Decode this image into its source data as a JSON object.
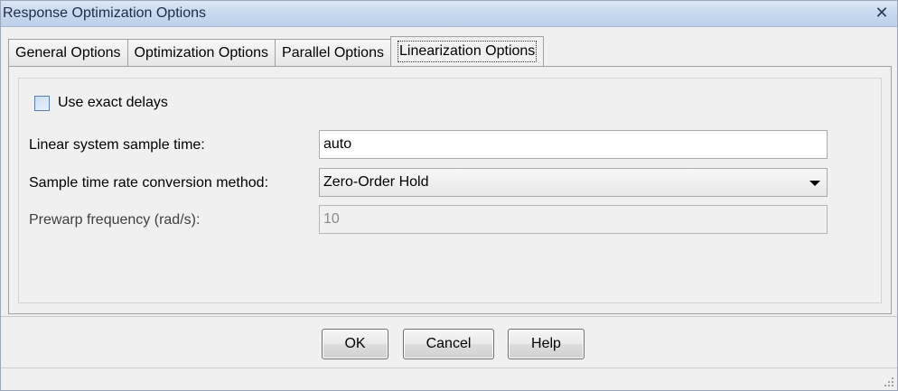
{
  "window": {
    "title": "Response Optimization Options",
    "close_glyph": "✕"
  },
  "tabs": [
    {
      "label": "General Options",
      "active": false
    },
    {
      "label": "Optimization Options",
      "active": false
    },
    {
      "label": "Parallel Options",
      "active": false
    },
    {
      "label": "Linearization Options",
      "active": true
    }
  ],
  "linearization": {
    "use_exact_delays_label": "Use exact delays",
    "use_exact_delays_checked": false,
    "sample_time_label": "Linear system sample time:",
    "sample_time_value": "auto",
    "rate_conversion_label": "Sample time rate conversion method:",
    "rate_conversion_value": "Zero-Order Hold",
    "prewarp_label": "Prewarp frequency (rad/s):",
    "prewarp_value": "10",
    "prewarp_enabled": false
  },
  "buttons": {
    "ok": "OK",
    "cancel": "Cancel",
    "help": "Help"
  },
  "colors": {
    "titlebar": "#c9d9ee",
    "background": "#f0f0f0",
    "checkbox_border": "#5a7ea8"
  }
}
